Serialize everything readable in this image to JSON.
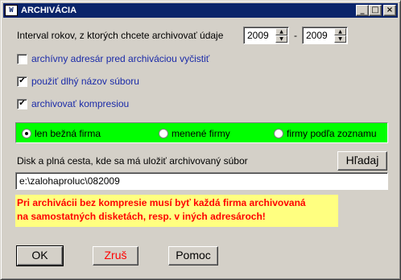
{
  "window": {
    "title": "ARCHIVÁCIA",
    "icon_glyph": "W",
    "minimize": "_",
    "maximize": "□",
    "close": "×"
  },
  "interval": {
    "label": "Interval rokov, z ktorých chcete archivovať údaje",
    "from_year": "2009",
    "separator": "-",
    "to_year": "2009",
    "up_arrow": "▲",
    "down_arrow": "▼"
  },
  "options": [
    {
      "label": "archívny adresár pred archiváciou vyčistiť",
      "checked": false
    },
    {
      "label": "použiť dlhý názov súboru",
      "checked": true
    },
    {
      "label": "archivovať kompresiou",
      "checked": true
    }
  ],
  "checkmark": "✔",
  "firm_scope": {
    "color": "#00ff00",
    "radios": [
      {
        "label": "len bežná firma",
        "selected": true
      },
      {
        "label": "menené firmy",
        "selected": false
      },
      {
        "label": "firmy podľa zoznamu",
        "selected": false
      }
    ]
  },
  "destination": {
    "label": "Disk a plná cesta, kde sa má uložiť archivovaný súbor",
    "browse_button": "Hľadaj",
    "path_value": "e:\\zalohaproluc\\082009"
  },
  "warning": {
    "line1": "Pri archivácii bez kompresie musí byť každá firma archivovaná",
    "line2": "na samostatných disketách, resp. v iných adresároch!",
    "background": "#ffff80",
    "color": "#ff0000"
  },
  "buttons": {
    "ok": "OK",
    "cancel": "Zruš",
    "help": "Pomoc"
  }
}
